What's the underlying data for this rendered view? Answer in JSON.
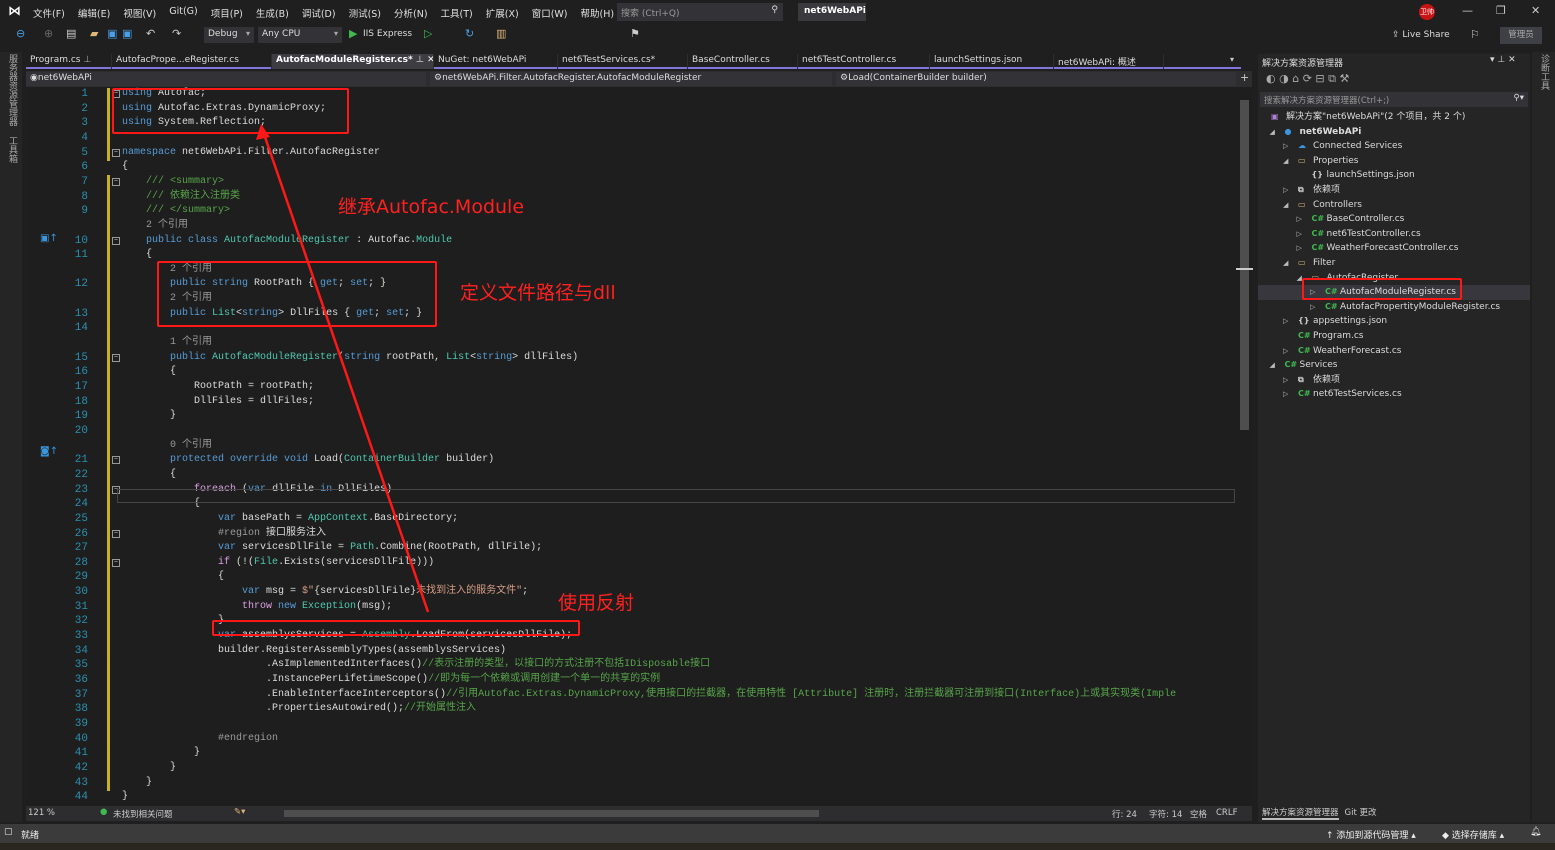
{
  "app": {
    "menus": [
      "文件(F)",
      "编辑(E)",
      "视图(V)",
      "Git(G)",
      "项目(P)",
      "生成(B)",
      "调试(D)",
      "测试(S)",
      "分析(N)",
      "工具(T)",
      "扩展(X)",
      "窗口(W)",
      "帮助(H)"
    ],
    "search_placeholder": "搜索 (Ctrl+Q)",
    "solution_name": "net6WebAPi",
    "user_badge": "卫帅",
    "live_share": "Live Share",
    "admin_label": "管理员"
  },
  "toolbar": {
    "config": "Debug",
    "platform": "Any CPU",
    "run_target": "IIS Express"
  },
  "side_strips": {
    "left": [
      "服务器资源管理器",
      "工具箱"
    ],
    "right": [
      "诊断工具"
    ]
  },
  "editor": {
    "tabs": [
      {
        "label": "Program.cs",
        "pinned": true
      },
      {
        "label": "AutofacPrope...eRegister.cs"
      },
      {
        "label": "AutofacModuleRegister.cs*",
        "active": true,
        "pinned": true
      },
      {
        "label": "NuGet: net6WebAPi"
      },
      {
        "label": "net6TestServices.cs*"
      },
      {
        "label": "BaseController.cs"
      },
      {
        "label": "net6TestController.cs"
      },
      {
        "label": "launchSettings.json"
      },
      {
        "label": "net6WebAPi: 概述"
      }
    ],
    "nav": {
      "project": "net6WebAPi",
      "type": "net6WebAPi.Filter.AutofacRegister.AutofacModuleRegister",
      "member": "Load(ContainerBuilder builder)"
    },
    "lines": [
      {
        "n": 1,
        "t": [
          [
            "using",
            "k"
          ],
          [
            " Autofac;",
            "p"
          ]
        ]
      },
      {
        "n": 2,
        "t": [
          [
            "using",
            "k"
          ],
          [
            " Autofac.Extras.DynamicProxy;",
            "p"
          ]
        ]
      },
      {
        "n": 3,
        "t": [
          [
            "using",
            "k"
          ],
          [
            " System.Reflection;",
            "p"
          ]
        ]
      },
      {
        "n": 4,
        "t": []
      },
      {
        "n": 5,
        "t": [
          [
            "namespace",
            "k"
          ],
          [
            " net6WebAPi.Filter.AutofacRegister",
            "p"
          ]
        ]
      },
      {
        "n": 6,
        "t": [
          [
            "{",
            "p"
          ]
        ]
      },
      {
        "n": 7,
        "t": [
          [
            "    /// <summary>",
            "c"
          ]
        ]
      },
      {
        "n": 8,
        "t": [
          [
            "    /// 依赖注入注册类",
            "c"
          ]
        ]
      },
      {
        "n": 9,
        "t": [
          [
            "    /// </summary>",
            "c"
          ]
        ]
      },
      {
        "lens": "    2 个引用"
      },
      {
        "n": 10,
        "t": [
          [
            "    public class ",
            "k"
          ],
          [
            "AutofacModuleRegister",
            "t"
          ],
          [
            " : Autofac.",
            "p"
          ],
          [
            "Module",
            "t"
          ]
        ]
      },
      {
        "n": 11,
        "t": [
          [
            "    {",
            "p"
          ]
        ]
      },
      {
        "lens": "        2 个引用"
      },
      {
        "n": 12,
        "t": [
          [
            "        public string ",
            "k"
          ],
          [
            "RootPath { ",
            "p"
          ],
          [
            "get",
            "k"
          ],
          [
            "; ",
            "p"
          ],
          [
            "set",
            "k"
          ],
          [
            "; }",
            "p"
          ]
        ]
      },
      {
        "lens": "        2 个引用"
      },
      {
        "n": 13,
        "t": [
          [
            "        public ",
            "k"
          ],
          [
            "List",
            "t"
          ],
          [
            "<",
            "p"
          ],
          [
            "string",
            "k"
          ],
          [
            "> DllFiles { ",
            "p"
          ],
          [
            "get",
            "k"
          ],
          [
            "; ",
            "p"
          ],
          [
            "set",
            "k"
          ],
          [
            "; }",
            "p"
          ]
        ]
      },
      {
        "n": 14,
        "t": []
      },
      {
        "lens": "        1 个引用"
      },
      {
        "n": 15,
        "t": [
          [
            "        public ",
            "k"
          ],
          [
            "AutofacModuleRegister",
            "t"
          ],
          [
            "(",
            "p"
          ],
          [
            "string",
            "k"
          ],
          [
            " rootPath, ",
            "p"
          ],
          [
            "List",
            "t"
          ],
          [
            "<",
            "p"
          ],
          [
            "string",
            "k"
          ],
          [
            "> dllFiles)",
            "p"
          ]
        ]
      },
      {
        "n": 16,
        "t": [
          [
            "        {",
            "p"
          ]
        ]
      },
      {
        "n": 17,
        "t": [
          [
            "            RootPath = rootPath;",
            "p"
          ]
        ]
      },
      {
        "n": 18,
        "t": [
          [
            "            DllFiles = dllFiles;",
            "p"
          ]
        ]
      },
      {
        "n": 19,
        "t": [
          [
            "        }",
            "p"
          ]
        ]
      },
      {
        "n": 20,
        "t": []
      },
      {
        "lens": "        0 个引用"
      },
      {
        "n": 21,
        "t": [
          [
            "        protected override void ",
            "k"
          ],
          [
            "Load(",
            "p"
          ],
          [
            "ContainerBuilder",
            "t"
          ],
          [
            " builder)",
            "p"
          ]
        ]
      },
      {
        "n": 22,
        "t": [
          [
            "        {",
            "p"
          ]
        ]
      },
      {
        "n": 23,
        "t": [
          [
            "            foreach",
            "f"
          ],
          [
            " (",
            "p"
          ],
          [
            "var",
            "k"
          ],
          [
            " dllFile ",
            "p"
          ],
          [
            "in",
            "k"
          ],
          [
            " DllFiles)",
            "p"
          ]
        ]
      },
      {
        "n": 24,
        "t": [
          [
            "            {",
            "p"
          ]
        ]
      },
      {
        "n": 25,
        "t": [
          [
            "                var",
            "k"
          ],
          [
            " basePath = ",
            "p"
          ],
          [
            "AppContext",
            "t"
          ],
          [
            ".BaseDirectory;",
            "p"
          ]
        ]
      },
      {
        "n": 26,
        "t": [
          [
            "                #region",
            "g"
          ],
          [
            " 接口服务注入",
            "p"
          ]
        ]
      },
      {
        "n": 27,
        "t": [
          [
            "                var",
            "k"
          ],
          [
            " servicesDllFile = ",
            "p"
          ],
          [
            "Path",
            "t"
          ],
          [
            ".Combine(RootPath, dllFile);",
            "p"
          ]
        ]
      },
      {
        "n": 28,
        "t": [
          [
            "                if",
            "f"
          ],
          [
            " (!(",
            "p"
          ],
          [
            "File",
            "t"
          ],
          [
            ".Exists(servicesDllFile)))",
            "p"
          ]
        ]
      },
      {
        "n": 29,
        "t": [
          [
            "                {",
            "p"
          ]
        ]
      },
      {
        "n": 30,
        "t": [
          [
            "                    var",
            "k"
          ],
          [
            " msg = ",
            "p"
          ],
          [
            "$\"",
            "s"
          ],
          [
            "{servicesDllFile}",
            "p"
          ],
          [
            "未找到注入的服务文件\"",
            "s"
          ],
          [
            ";",
            "p"
          ]
        ]
      },
      {
        "n": 31,
        "t": [
          [
            "                    throw",
            "f"
          ],
          [
            " new ",
            "k"
          ],
          [
            "Exception",
            "t"
          ],
          [
            "(msg);",
            "p"
          ]
        ]
      },
      {
        "n": 32,
        "t": [
          [
            "                }",
            "p"
          ]
        ]
      },
      {
        "n": 33,
        "t": [
          [
            "                var",
            "k"
          ],
          [
            " assemblysServices = ",
            "p"
          ],
          [
            "Assembly",
            "t"
          ],
          [
            ".LoadFrom(servicesDllFile);",
            "p"
          ]
        ]
      },
      {
        "n": 34,
        "t": [
          [
            "                builder.RegisterAssemblyTypes(assemblysServices)",
            "p"
          ]
        ]
      },
      {
        "n": 35,
        "t": [
          [
            "                        .AsImplementedInterfaces()",
            "p"
          ],
          [
            "//表示注册的类型，以接口的方式注册不包括IDisposable接口",
            "c"
          ]
        ]
      },
      {
        "n": 36,
        "t": [
          [
            "                        .InstancePerLifetimeScope()",
            "p"
          ],
          [
            "//即为每一个依赖或调用创建一个单一的共享的实例",
            "c"
          ]
        ]
      },
      {
        "n": 37,
        "t": [
          [
            "                        .EnableInterfaceInterceptors()",
            "p"
          ],
          [
            "//引用Autofac.Extras.DynamicProxy,使用接口的拦截器，在使用特性 [Attribute] 注册时，注册拦截器可注册到接口(Interface)上或其实现类(Imple",
            "c"
          ]
        ]
      },
      {
        "n": 38,
        "t": [
          [
            "                        .PropertiesAutowired();",
            "p"
          ],
          [
            "//开始属性注入",
            "c"
          ]
        ]
      },
      {
        "n": 39,
        "t": []
      },
      {
        "n": 40,
        "t": [
          [
            "                #endregion",
            "g"
          ]
        ]
      },
      {
        "n": 41,
        "t": [
          [
            "            }",
            "p"
          ]
        ]
      },
      {
        "n": 42,
        "t": [
          [
            "        }",
            "p"
          ]
        ]
      },
      {
        "n": 43,
        "t": [
          [
            "    }",
            "p"
          ]
        ]
      },
      {
        "n": 44,
        "t": [
          [
            "}",
            "p"
          ]
        ]
      },
      {
        "n": 45,
        "t": []
      }
    ],
    "status": {
      "zoom": "121 %",
      "issues": "未找到相关问题",
      "line": "行: 24",
      "char": "字符: 14",
      "whitespace": "空格",
      "eol": "CRLF"
    }
  },
  "annotations": {
    "inherit": "继承Autofac.Module",
    "define": "定义文件路径与dll",
    "reflect": "使用反射",
    "color": "#ff2020"
  },
  "solution_explorer": {
    "title": "解决方案资源管理器",
    "search_placeholder": "搜索解决方案资源管理器(Ctrl+;)",
    "items": [
      {
        "label": "解决方案\"net6WebAPi\"(2 个项目，共 2 个)",
        "depth": 0,
        "icon": "solution"
      },
      {
        "label": "net6WebAPi",
        "depth": 1,
        "arrow": "down",
        "icon": "project",
        "bold": true
      },
      {
        "label": "Connected Services",
        "depth": 2,
        "arrow": "right",
        "icon": "cloud"
      },
      {
        "label": "Properties",
        "depth": 2,
        "arrow": "down",
        "icon": "folder"
      },
      {
        "label": "launchSettings.json",
        "depth": 3,
        "icon": "json"
      },
      {
        "label": "依赖项",
        "depth": 2,
        "arrow": "right",
        "icon": "deps"
      },
      {
        "label": "Controllers",
        "depth": 2,
        "arrow": "down",
        "icon": "folder"
      },
      {
        "label": "BaseController.cs",
        "depth": 3,
        "arrow": "right",
        "icon": "csharp"
      },
      {
        "label": "net6TestController.cs",
        "depth": 3,
        "arrow": "right",
        "icon": "csharp"
      },
      {
        "label": "WeatherForecastController.cs",
        "depth": 3,
        "arrow": "right",
        "icon": "csharp"
      },
      {
        "label": "Filter",
        "depth": 2,
        "arrow": "down",
        "icon": "folder"
      },
      {
        "label": "AutofacRegister",
        "depth": 3,
        "arrow": "down",
        "icon": "folder"
      },
      {
        "label": "AutofacModuleRegister.cs",
        "depth": 4,
        "arrow": "right",
        "icon": "csharp",
        "selected": true
      },
      {
        "label": "AutofacPropertityModuleRegister.cs",
        "depth": 4,
        "arrow": "right",
        "icon": "csharp"
      },
      {
        "label": "appsettings.json",
        "depth": 2,
        "arrow": "right",
        "icon": "json"
      },
      {
        "label": "Program.cs",
        "depth": 2,
        "icon": "csharp"
      },
      {
        "label": "WeatherForecast.cs",
        "depth": 2,
        "arrow": "right",
        "icon": "csharp"
      },
      {
        "label": "Services",
        "depth": 1,
        "arrow": "down",
        "icon": "project-cs"
      },
      {
        "label": "依赖项",
        "depth": 2,
        "arrow": "right",
        "icon": "deps"
      },
      {
        "label": "net6TestServices.cs",
        "depth": 2,
        "arrow": "right",
        "icon": "csharp"
      }
    ],
    "bottom_tabs": [
      "解决方案资源管理器",
      "Git 更改"
    ]
  },
  "statusbar": {
    "ready": "就绪",
    "add_source": "添加到源代码管理",
    "select_repo": "选择存储库"
  }
}
